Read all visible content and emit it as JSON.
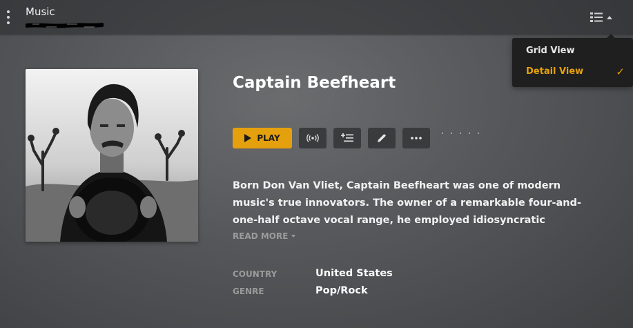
{
  "header": {
    "title": "Music",
    "subtitle_redacted": true
  },
  "view_menu": {
    "icon": "list-view-icon",
    "items": [
      {
        "label": "Grid View",
        "selected": false
      },
      {
        "label": "Detail View",
        "selected": true
      }
    ],
    "accent_color": "#e5a00d"
  },
  "artist": {
    "name": "Captain Beefheart",
    "artwork_icon": "artist-photo"
  },
  "actions": {
    "play_label": "PLAY",
    "play_color": "#e5a00d",
    "buttons": [
      "radio-icon",
      "add-to-queue-icon",
      "edit-icon",
      "more-icon"
    ],
    "rating_dots": 5
  },
  "summary": {
    "text": "Born Don Van Vliet, Captain Beefheart was one of modern music's true innovators. The owner of a remarkable four-and-one-half octave vocal range, he employed idiosyncratic rhythms, absurdist lyrics and an",
    "read_more_label": "READ MORE"
  },
  "details": [
    {
      "label": "COUNTRY",
      "value": "United States"
    },
    {
      "label": "GENRE",
      "value": "Pop/Rock"
    }
  ]
}
